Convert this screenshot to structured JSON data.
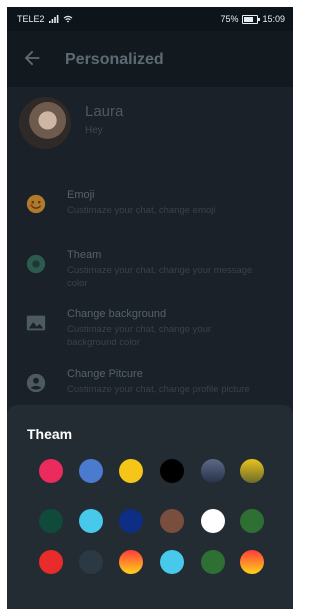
{
  "statusbar": {
    "carrier": "TELE2",
    "battery_text": "75%",
    "battery_level": 0.75,
    "time": "15:09",
    "icons": [
      "signal-icon",
      "wifi-icon",
      "battery-icon"
    ]
  },
  "appbar": {
    "back_icon": "arrow-left-icon",
    "title": "Personalized"
  },
  "profile": {
    "name": "Laura",
    "status": "Hey"
  },
  "menu": [
    {
      "icon": "emoji-icon",
      "title": "Emoji",
      "subtitle": "Custimaze your chat, change emoji"
    },
    {
      "icon": "theme-circle-icon",
      "title": "Theam",
      "subtitle": "Custimaze your chat, change  your message color"
    },
    {
      "icon": "image-icon",
      "title": "Change background",
      "subtitle": "Custimaze your chat, change your background color"
    },
    {
      "icon": "account-circle-icon",
      "title": "Change Pitcure",
      "subtitle": "Custimaze your chat, change profile picture"
    }
  ],
  "sheet": {
    "title": "Theam",
    "swatches": [
      [
        "#ea2b5c",
        "#4a7bcf",
        "#f5c518",
        "#000000",
        "linear-gradient(180deg,#5b6a86,#27324a)",
        "linear-gradient(180deg,#e9c41c,#6d6b2a)"
      ],
      [
        "#0f4a3a",
        "#47c9ec",
        "#0e2e86",
        "#7a4e3e",
        "#ffffff",
        "#2e6f33"
      ],
      [
        "#e82b2b",
        "#2b3944",
        "linear-gradient(180deg,#ff3b3b,#ffd31a)",
        "#47c9ec",
        "#2e6f33",
        "linear-gradient(180deg,#ff3b3b,#ffd31a)"
      ]
    ]
  }
}
